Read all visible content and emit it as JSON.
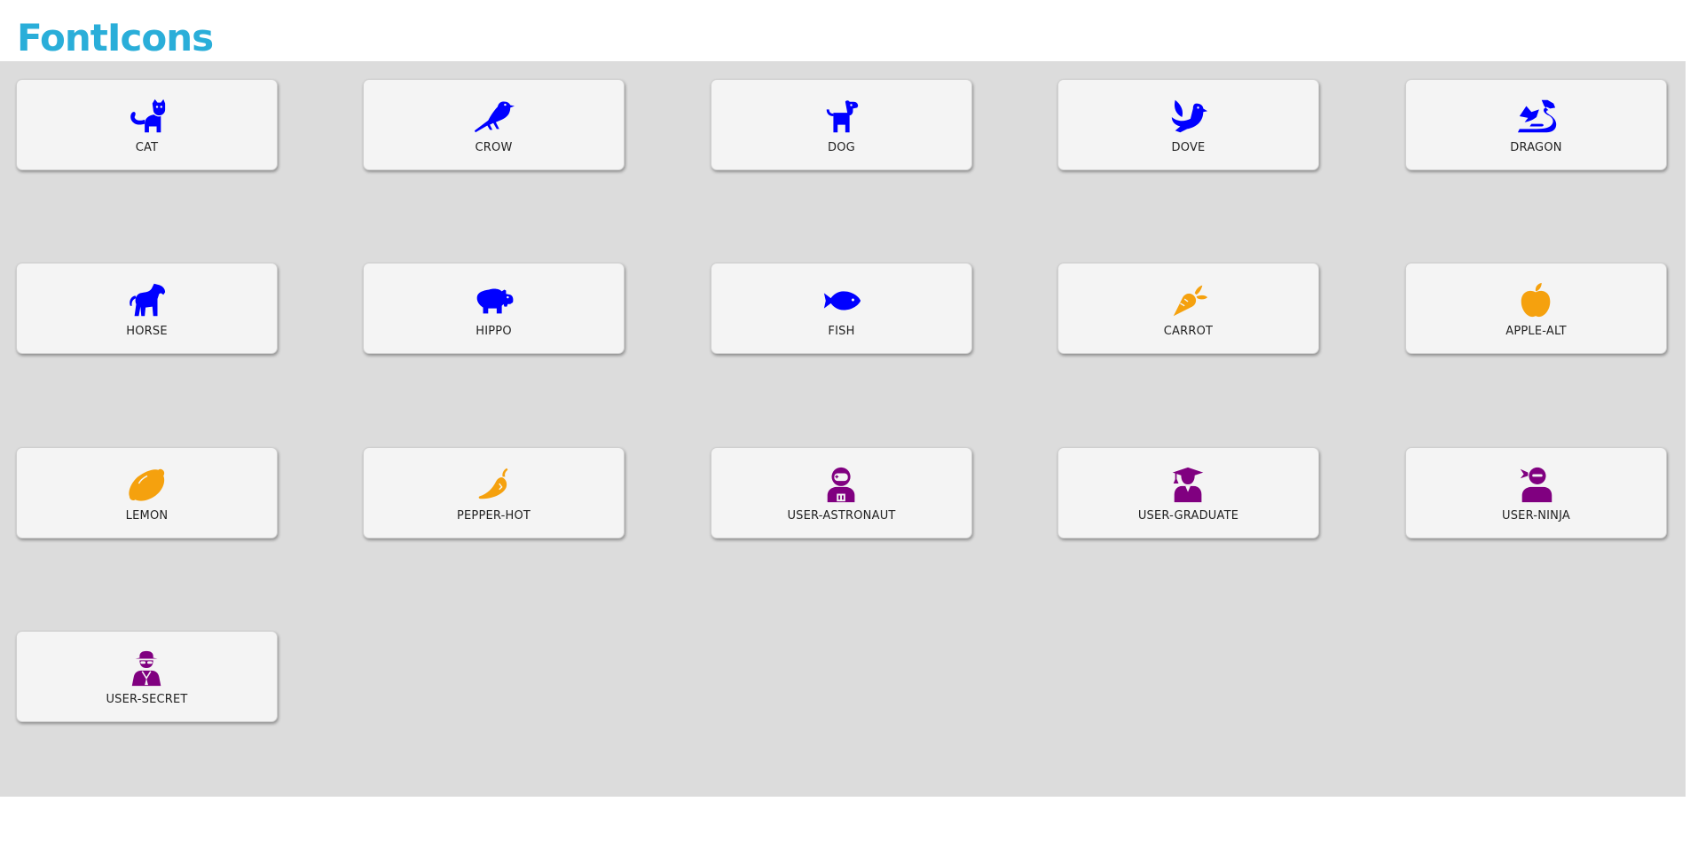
{
  "page": {
    "title": "FontIcons"
  },
  "colors": {
    "title": "#2aaed9",
    "animal": "#0000ff",
    "food": "#f5a10e",
    "user": "#800080",
    "panel_bg": "#dcdcdc",
    "card_bg": "#f4f4f4"
  },
  "cards": [
    {
      "label": "CAT",
      "icon": "cat-icon",
      "group": "animal"
    },
    {
      "label": "CROW",
      "icon": "crow-icon",
      "group": "animal"
    },
    {
      "label": "DOG",
      "icon": "dog-icon",
      "group": "animal"
    },
    {
      "label": "DOVE",
      "icon": "dove-icon",
      "group": "animal"
    },
    {
      "label": "DRAGON",
      "icon": "dragon-icon",
      "group": "animal"
    },
    {
      "label": "HORSE",
      "icon": "horse-icon",
      "group": "animal"
    },
    {
      "label": "HIPPO",
      "icon": "hippo-icon",
      "group": "animal"
    },
    {
      "label": "FISH",
      "icon": "fish-icon",
      "group": "animal"
    },
    {
      "label": "CARROT",
      "icon": "carrot-icon",
      "group": "food"
    },
    {
      "label": "APPLE-ALT",
      "icon": "apple-alt-icon",
      "group": "food"
    },
    {
      "label": "LEMON",
      "icon": "lemon-icon",
      "group": "food"
    },
    {
      "label": "PEPPER-HOT",
      "icon": "pepper-hot-icon",
      "group": "food"
    },
    {
      "label": "USER-ASTRONAUT",
      "icon": "user-astronaut-icon",
      "group": "user"
    },
    {
      "label": "USER-GRADUATE",
      "icon": "user-graduate-icon",
      "group": "user"
    },
    {
      "label": "USER-NINJA",
      "icon": "user-ninja-icon",
      "group": "user"
    },
    {
      "label": "USER-SECRET",
      "icon": "user-secret-icon",
      "group": "user"
    }
  ]
}
